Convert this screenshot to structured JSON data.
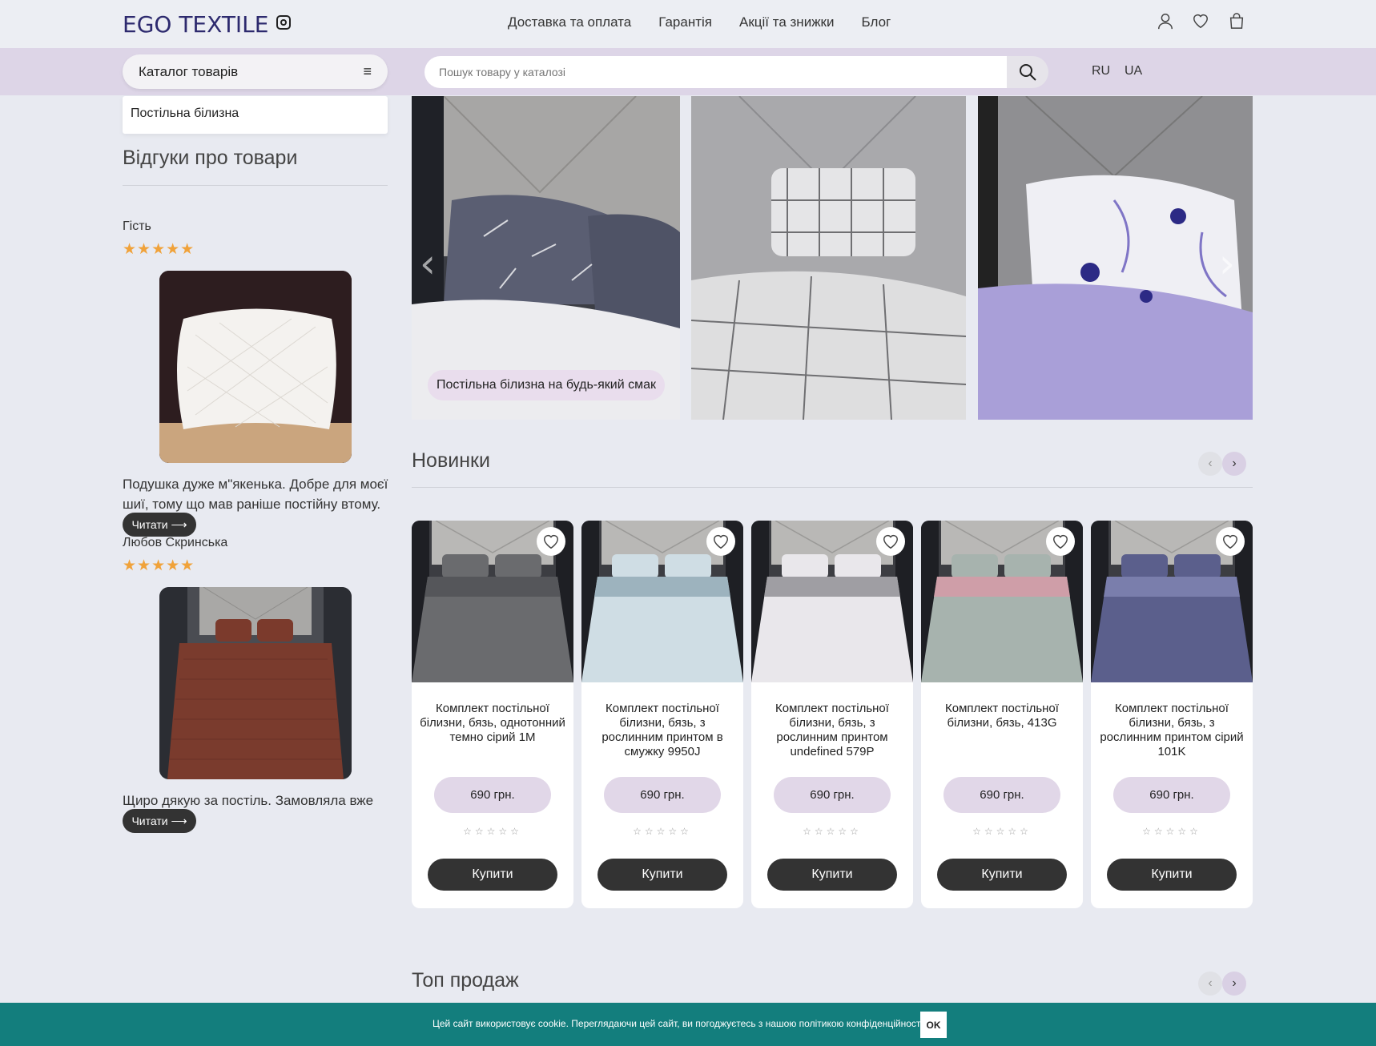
{
  "header": {
    "logo": "EGO TEXTILE",
    "nav": [
      "Доставка та оплата",
      "Гарантія",
      "Акції та знижки",
      "Блог"
    ]
  },
  "bar": {
    "catalog_label": "Каталог товарів",
    "search_placeholder": "Пошук товару у каталозі",
    "lang_ru": "RU",
    "lang_ua": "UA"
  },
  "sidebar": {
    "category": "Постільна білизна",
    "reviews_title": "Відгуки про товари",
    "reviews": [
      {
        "author": "Гість",
        "rating": 5,
        "text": "Подушка дуже м\"якенька. Добре для моєї шиї, тому що мав раніше постійну втому.",
        "read_label": "Читати ⟶"
      },
      {
        "author": "Любов Скринська",
        "rating": 5,
        "text": "Щиро дякую за постіль. Замовляла вже вдруге.",
        "read_label": "Читати ⟶"
      }
    ]
  },
  "hero": {
    "caption": "Постільна білизна на будь-який смак"
  },
  "new_section": {
    "title": "Новинки",
    "products": [
      {
        "title": "Комплект постільної білизни, бязь, однотонний темно сірий 1М",
        "price": "690 грн.",
        "buy": "Купити"
      },
      {
        "title": "Комплект постільної білизни, бязь, з рослинним принтом в смужку 9950J",
        "price": "690 грн.",
        "buy": "Купити"
      },
      {
        "title": "Комплект постільної білизни, бязь, з рослинним принтом undefined 579P",
        "price": "690 грн.",
        "buy": "Купити"
      },
      {
        "title": "Комплект постільної білизни, бязь, 413G",
        "price": "690 грн.",
        "buy": "Купити"
      },
      {
        "title": "Комплект постільної білизни, бязь, з рослинним принтом сірий 101K",
        "price": "690 грн.",
        "buy": "Купити"
      }
    ]
  },
  "top_section": {
    "title": "Топ продаж"
  },
  "cookie": {
    "text": "Цей сайт використовує cookie. Переглядаючи цей сайт, ви погоджуєтесь з нашою політикою конфіденційності.",
    "ok": "OK"
  },
  "colors": {
    "accent_purple": "#ddd5e7",
    "dark_button": "#333333",
    "cookie_bar": "#137e7d",
    "star": "#f0a23a"
  }
}
